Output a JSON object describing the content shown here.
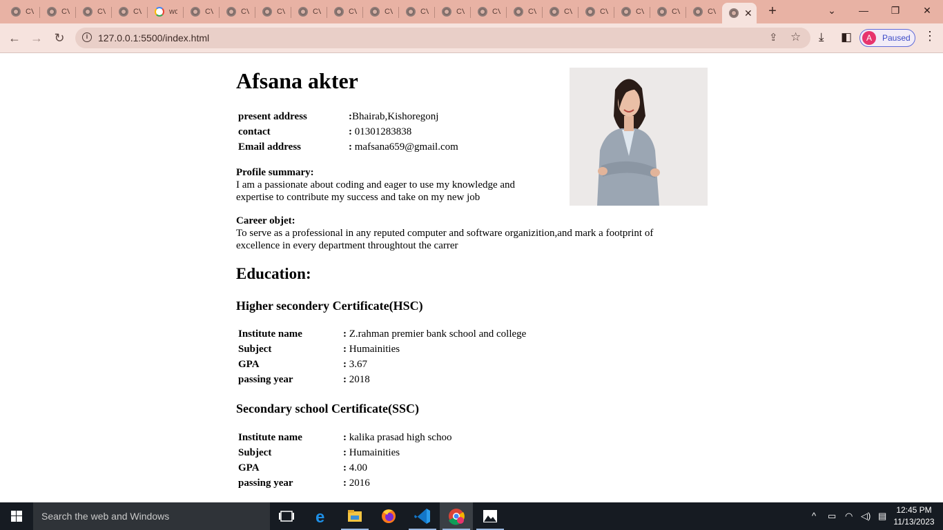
{
  "browser": {
    "tab_title": "CV",
    "google_tab_title": "wo",
    "close_glyph": "✕",
    "new_tab_glyph": "+",
    "url": "127.0.0.1:5500/index.html",
    "profile_initial": "A",
    "profile_status": "Paused",
    "window_controls": {
      "tab_search": "⌄",
      "minimize": "—",
      "restore": "❐",
      "close": "✕"
    }
  },
  "resume": {
    "name": "Afsana akter",
    "contact_rows": [
      {
        "label": "present address",
        "sep": ":",
        "value": "Bhairab,Kishoregonj"
      },
      {
        "label": "contact",
        "sep": ": ",
        "value": "01301283838"
      },
      {
        "label": "Email address",
        "sep": ": ",
        "value": "mafsana659@gmail.com"
      }
    ],
    "profile_summary": {
      "heading": "Profile summary:",
      "line1": "I am a passionate about coding and eager to use my knowledge and",
      "line2": "expertise to contribute my success and take on my new job"
    },
    "career": {
      "heading": "Career objet:",
      "line1": "To serve as a professional in any reputed computer and software organizition,and mark a footprint of",
      "line2": "excellence in every department throughtout the carrer"
    },
    "education_heading": "Education:",
    "hsc": {
      "title": "Higher secondery Certificate(HSC)",
      "rows": [
        {
          "label": "Institute name",
          "sep": ": ",
          "value": "Z.rahman premier bank school and college"
        },
        {
          "label": "Subject",
          "sep": ": ",
          "value": "Humainities"
        },
        {
          "label": "GPA",
          "sep": ": ",
          "value": "3.67"
        },
        {
          "label": "passing year",
          "sep": ": ",
          "value": "2018"
        }
      ]
    },
    "ssc": {
      "title": "Secondary school Certificate(SSC)",
      "rows": [
        {
          "label": "Institute name",
          "sep": ": ",
          "value": "kalika prasad high schoo"
        },
        {
          "label": "Subject",
          "sep": ": ",
          "value": "Humainities"
        },
        {
          "label": "GPA",
          "sep": ": ",
          "value": "4.00"
        },
        {
          "label": "passing year",
          "sep": ": ",
          "value": "2016"
        }
      ]
    }
  },
  "taskbar": {
    "search_placeholder": "Search the web and Windows",
    "time": "12:45 PM",
    "date": "11/13/2023"
  },
  "colors": {
    "tab_strip": "#e8b2a4",
    "toolbar": "#f6e3de",
    "paused_pill_border": "#5f6bd9",
    "avatar": "#e7346d",
    "taskbar": "#161b22"
  }
}
